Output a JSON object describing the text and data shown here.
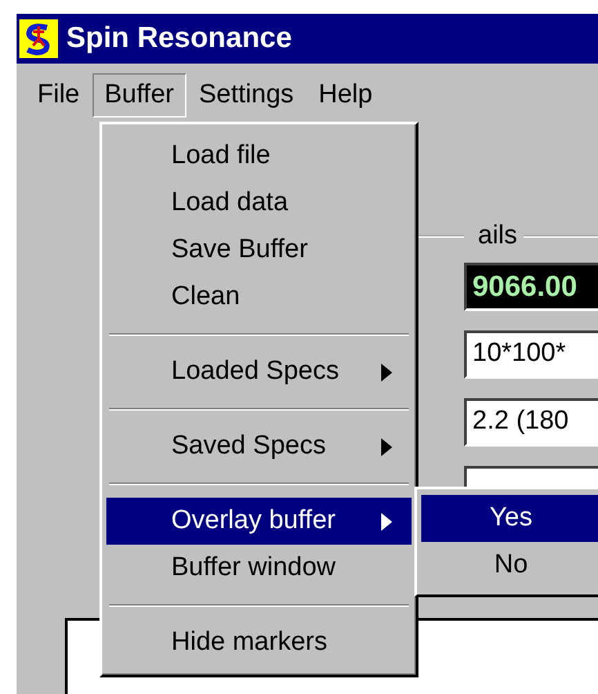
{
  "window": {
    "title": "Spin Resonance"
  },
  "menu_bar": [
    {
      "label": "File",
      "selected": false
    },
    {
      "label": "Buffer",
      "selected": true
    },
    {
      "label": "Settings",
      "selected": false
    },
    {
      "label": "Help",
      "selected": false
    }
  ],
  "menu": [
    {
      "kind": "item",
      "label": "Load file",
      "selected": false
    },
    {
      "kind": "item",
      "label": "Load data",
      "selected": false
    },
    {
      "kind": "item",
      "label": "Save Buffer",
      "selected": false
    },
    {
      "kind": "item",
      "label": "Clean",
      "selected": false
    },
    {
      "kind": "separator"
    },
    {
      "kind": "submenu",
      "label": "Loaded Specs",
      "selected": false
    },
    {
      "kind": "separator"
    },
    {
      "kind": "submenu",
      "label": "Saved Specs",
      "selected": false
    },
    {
      "kind": "separator"
    },
    {
      "kind": "submenu",
      "label": "Overlay buffer",
      "selected": true
    },
    {
      "kind": "item",
      "label": "Buffer window",
      "selected": false
    },
    {
      "kind": "separator"
    },
    {
      "kind": "item",
      "label": "Hide markers",
      "selected": false
    }
  ],
  "submenu": [
    {
      "label": "Yes",
      "selected": true
    },
    {
      "label": "No",
      "selected": false
    }
  ],
  "group": {
    "label": "ails",
    "fields": [
      {
        "kind": "readout",
        "value": "9066.00"
      },
      {
        "kind": "text",
        "value": "10*100*"
      },
      {
        "kind": "text",
        "value": "2.2 (180"
      },
      {
        "kind": "text"
      }
    ]
  }
}
